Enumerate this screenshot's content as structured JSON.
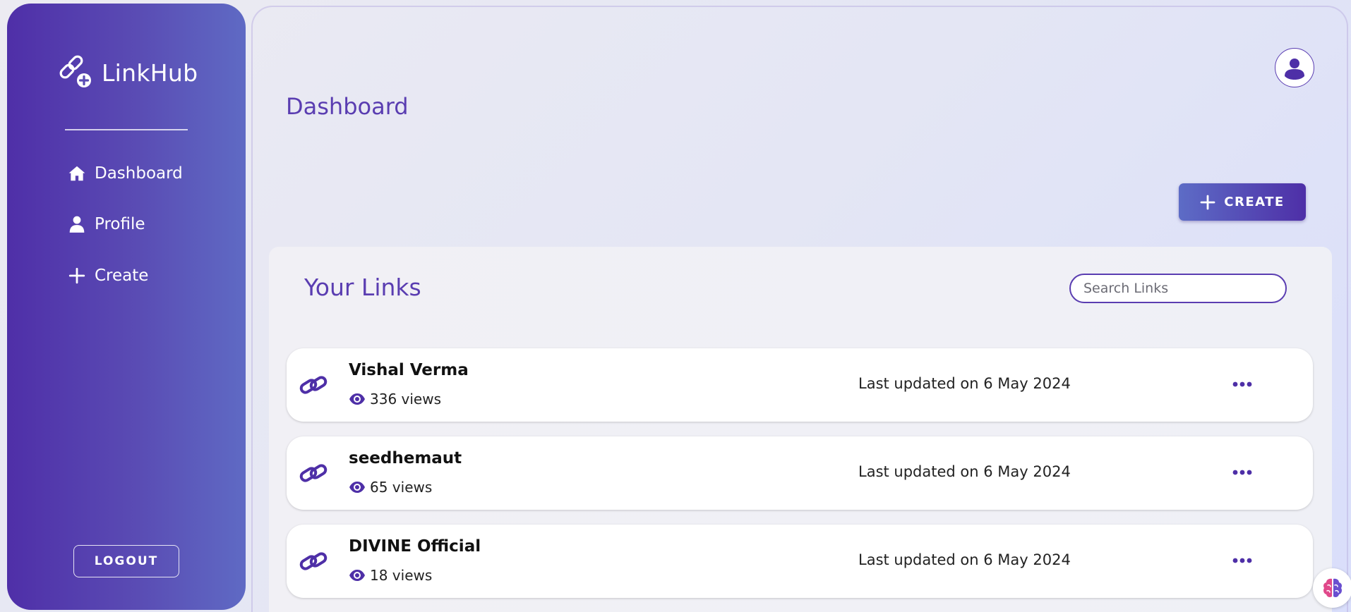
{
  "brand": {
    "name": "LinkHub",
    "logo_icon": "link-plus-icon"
  },
  "sidebar": {
    "items": [
      {
        "label": "Dashboard",
        "icon": "home-icon"
      },
      {
        "label": "Profile",
        "icon": "user-icon"
      },
      {
        "label": "Create",
        "icon": "plus-icon"
      }
    ],
    "logout_label": "LOGOUT"
  },
  "header": {
    "title": "Dashboard",
    "avatar_icon": "user-circle-icon",
    "create_label": "CREATE"
  },
  "links_panel": {
    "title": "Your Links",
    "search_placeholder": "Search Links",
    "items": [
      {
        "name": "Vishal Verma",
        "views": "336 views",
        "updated": "Last updated on 6 May 2024"
      },
      {
        "name": "seedhemaut",
        "views": "65 views",
        "updated": "Last updated on 6 May 2024"
      },
      {
        "name": "DIVINE Official",
        "views": "18 views",
        "updated": "Last updated on 6 May 2024"
      }
    ]
  },
  "colors": {
    "accent": "#5a3db1",
    "sidebar_start": "#4f2fa8",
    "sidebar_end": "#5f6ac4"
  }
}
